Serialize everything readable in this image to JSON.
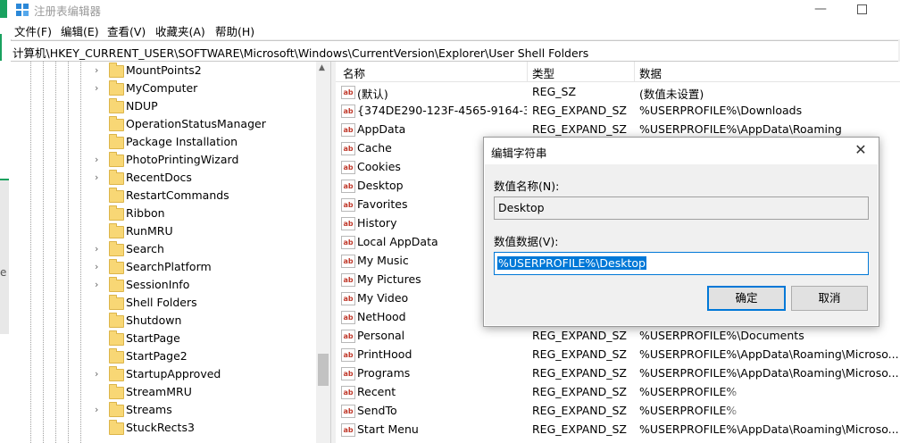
{
  "window": {
    "title": "注册表编辑器",
    "min_glyph": "—"
  },
  "menu": [
    "文件(F)",
    "编辑(E)",
    "查看(V)",
    "收藏夹(A)",
    "帮助(H)"
  ],
  "address": "计算机\\HKEY_CURRENT_USER\\SOFTWARE\\Microsoft\\Windows\\CurrentVersion\\Explorer\\User Shell Folders",
  "tree": {
    "items": [
      {
        "label": "MountPoints2",
        "expandable": true
      },
      {
        "label": "MyComputer",
        "expandable": true
      },
      {
        "label": "NDUP",
        "expandable": false
      },
      {
        "label": "OperationStatusManager",
        "expandable": false
      },
      {
        "label": "Package Installation",
        "expandable": false
      },
      {
        "label": "PhotoPrintingWizard",
        "expandable": true
      },
      {
        "label": "RecentDocs",
        "expandable": true
      },
      {
        "label": "RestartCommands",
        "expandable": false
      },
      {
        "label": "Ribbon",
        "expandable": false
      },
      {
        "label": "RunMRU",
        "expandable": false
      },
      {
        "label": "Search",
        "expandable": true
      },
      {
        "label": "SearchPlatform",
        "expandable": true
      },
      {
        "label": "SessionInfo",
        "expandable": true
      },
      {
        "label": "Shell Folders",
        "expandable": false
      },
      {
        "label": "Shutdown",
        "expandable": false
      },
      {
        "label": "StartPage",
        "expandable": false
      },
      {
        "label": "StartPage2",
        "expandable": false
      },
      {
        "label": "StartupApproved",
        "expandable": true
      },
      {
        "label": "StreamMRU",
        "expandable": false
      },
      {
        "label": "Streams",
        "expandable": true
      },
      {
        "label": "StuckRects3",
        "expandable": false
      }
    ]
  },
  "list": {
    "columns": {
      "name": "名称",
      "type": "类型",
      "data": "数据"
    },
    "rows": [
      {
        "name": "(默认)",
        "type": "REG_SZ",
        "data": "(数值未设置)"
      },
      {
        "name": "{374DE290-123F-4565-9164-39...",
        "type": "REG_EXPAND_SZ",
        "data": "%USERPROFILE%\\Downloads"
      },
      {
        "name": "AppData",
        "type": "REG_EXPAND_SZ",
        "data": "%USERPROFILE%\\AppData\\Roaming"
      },
      {
        "name": "Cache",
        "type": "",
        "data": ""
      },
      {
        "name": "Cookies",
        "type": "",
        "data": ""
      },
      {
        "name": "Desktop",
        "type": "",
        "data": ""
      },
      {
        "name": "Favorites",
        "type": "",
        "data": ""
      },
      {
        "name": "History",
        "type": "",
        "data": ""
      },
      {
        "name": "Local AppData",
        "type": "",
        "data": ""
      },
      {
        "name": "My Music",
        "type": "",
        "data": ""
      },
      {
        "name": "My Pictures",
        "type": "",
        "data": ""
      },
      {
        "name": "My Video",
        "type": "",
        "data": ""
      },
      {
        "name": "NetHood",
        "type": "",
        "data": ""
      },
      {
        "name": "Personal",
        "type": "REG_EXPAND_SZ",
        "data": "%USERPROFILE%\\Documents"
      },
      {
        "name": "PrintHood",
        "type": "REG_EXPAND_SZ",
        "data": "%USERPROFILE%\\AppData\\Roaming\\Microso..."
      },
      {
        "name": "Programs",
        "type": "REG_EXPAND_SZ",
        "data": "%USERPROFILE%\\AppData\\Roaming\\Microso..."
      },
      {
        "name": "Recent",
        "type": "REG_EXPAND_SZ",
        "data": "%USERPROFILE%"
      },
      {
        "name": "SendTo",
        "type": "REG_EXPAND_SZ",
        "data": "%USERPROFILE%"
      },
      {
        "name": "Start Menu",
        "type": "REG_EXPAND_SZ",
        "data": "%USERPROFILE%\\AppData\\Roaming\\Microso..."
      }
    ]
  },
  "dialog": {
    "title": "编辑字符串",
    "close_glyph": "✕",
    "name_label": "数值名称(N):",
    "name_value": "Desktop",
    "data_label": "数值数据(V):",
    "data_value": "%USERPROFILE%\\Desktop",
    "ok_label": "确定",
    "cancel_label": "取消"
  },
  "colors": {
    "accent": "#0078d7",
    "folder": "#f8d775"
  }
}
